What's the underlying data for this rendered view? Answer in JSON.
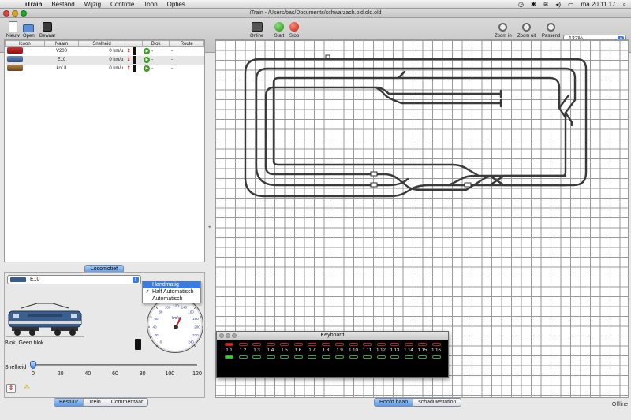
{
  "menubar": {
    "app": "iTrain",
    "items": [
      "Bestand",
      "Wijzig",
      "Controle",
      "Toon",
      "Opties"
    ],
    "clock": "ma 20 11 17"
  },
  "window": {
    "title": "iTrain - /Users/bas/Documents/schwarzach.old.old.old"
  },
  "toolbar": {
    "new": "Nieuw",
    "open": "Open",
    "save": "Bewaar",
    "online": "Online",
    "start": "Start",
    "stop": "Stop",
    "zoom_in": "Zoom in",
    "zoom_out": "Zoom uit",
    "fit": "Passend",
    "zoom_value": "127%"
  },
  "loco_table": {
    "headers": [
      "Icoon",
      "Naam",
      "Snelheid",
      "",
      "Blok",
      "Route"
    ],
    "rows": [
      {
        "name": "V200",
        "speed": "0 km/u",
        "block": "-",
        "route": "-"
      },
      {
        "name": "E10",
        "speed": "0 km/u",
        "block": "-",
        "route": "-"
      },
      {
        "name": "kof II",
        "speed": "0 km/u",
        "block": "-",
        "route": "-"
      }
    ]
  },
  "left_tabs": {
    "loco": "Locomotief"
  },
  "control": {
    "selected_loco": "E10",
    "mode_options": [
      "Handmatig",
      "Half Automatisch",
      "Automatisch"
    ],
    "mode_selected": "Half Automatisch",
    "blok_label": "Blok",
    "blok_value": "Geen blok",
    "speed_label": "Snelheid",
    "speed_ticks": [
      "0",
      "20",
      "40",
      "60",
      "80",
      "100",
      "120"
    ],
    "speed_value": 0,
    "speed_max": 120,
    "meter_unit": "km/u",
    "meter_ticks": [
      "0",
      "20",
      "40",
      "60",
      "80",
      "100",
      "120",
      "140",
      "160",
      "180",
      "200",
      "220",
      "240"
    ]
  },
  "bottom_tabs_left": [
    "Bestuur",
    "Trein",
    "Commentaar"
  ],
  "bottom_tabs_right": [
    "Hoofd baan",
    "schaduwstation"
  ],
  "keyboard": {
    "title": "Keyboard",
    "keys": [
      "1.1",
      "1.2",
      "1.3",
      "1.4",
      "1.5",
      "1.6",
      "1.7",
      "1.8",
      "1.9",
      "1.10",
      "1.11",
      "1.12",
      "1.13",
      "1.14",
      "1.15",
      "1.16"
    ]
  },
  "status": "Offline",
  "colors": {
    "accent": "#3a7be0",
    "track": "#3a3a3a",
    "led_red": "#d22",
    "led_green": "#2d2"
  }
}
